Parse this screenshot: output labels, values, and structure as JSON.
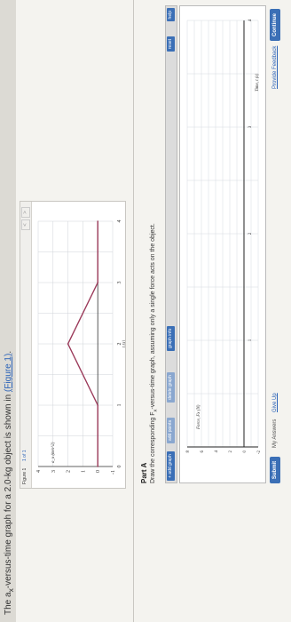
{
  "prompt": {
    "text_before": "The a",
    "sub": "x",
    "text_after": "-versus-time graph for a 2.0-kg object is shown in ",
    "link": "(Figure 1)",
    "end": "."
  },
  "figure": {
    "tab_label": "Figure 1",
    "nav_label": "1 of 1",
    "prev_label": "<",
    "next_label": ">",
    "chart_data": {
      "type": "line",
      "x": [
        0,
        1,
        2,
        3,
        4
      ],
      "y": [
        0,
        0,
        2,
        0,
        0
      ],
      "xlabel": "t (s)",
      "ylabel": "a_x (m/s^2)",
      "xlim": [
        0,
        4
      ],
      "ylim": [
        -1,
        4
      ],
      "x_ticks": [
        "0",
        "1",
        "2",
        "3",
        "4"
      ],
      "y_ticks": [
        "-1",
        "0",
        "1",
        "2",
        "3",
        "4"
      ],
      "grid": true,
      "line_color": "#9b3a5a"
    }
  },
  "partA": {
    "title": "Part A",
    "instruction_a": "Draw the corresponding F",
    "instruction_sub": "x",
    "instruction_b": "-versus-time graph, assuming only a single force acts on the object."
  },
  "toolbar": {
    "add_graph": "+ add graph",
    "add_points": "add points",
    "delete_graph": "delete graph",
    "graph_info": "graph info",
    "reset": "reset",
    "help": "help"
  },
  "answer_graph": {
    "chart_data": {
      "type": "line",
      "x": [],
      "y": [],
      "xlabel": "Time, t (s)",
      "ylabel": "Force, Fx (N)",
      "xlim": [
        0,
        4
      ],
      "ylim": [
        -2,
        8
      ],
      "x_ticks": [
        "1",
        "2",
        "3",
        "4"
      ],
      "y_ticks": [
        "-2",
        "0",
        "2",
        "4",
        "6",
        "8"
      ],
      "grid": true
    }
  },
  "footer": {
    "submit": "Submit",
    "my_answers": "My Answers",
    "give_up": "Give Up",
    "feedback": "Provide Feedback",
    "continue": "Continue"
  },
  "colors": {
    "accent": "#3b6fb6",
    "link": "#2a62b8"
  }
}
